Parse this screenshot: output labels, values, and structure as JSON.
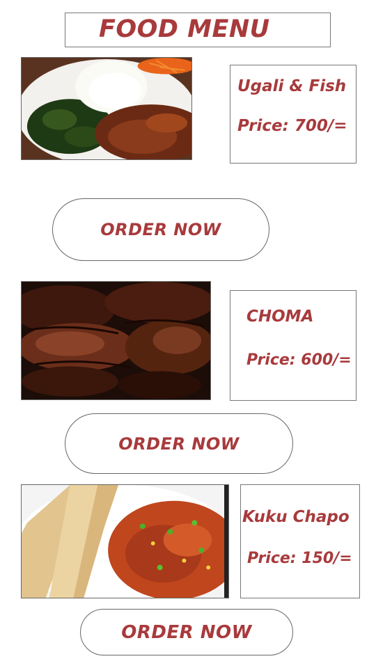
{
  "header": {
    "title": "FOOD MENU"
  },
  "menu": {
    "items": [
      {
        "name": "Ugali & Fish",
        "price": "Price: 700/=",
        "order_label": "ORDER NOW",
        "image": "ugali-fish-photo"
      },
      {
        "name": "CHOMA",
        "price": "Price: 600/=",
        "order_label": "ORDER NOW",
        "image": "nyama-choma-photo"
      },
      {
        "name": "Kuku Chapo",
        "price": "Price: 150/=",
        "order_label": "ORDER NOW",
        "image": "kuku-chapo-photo"
      }
    ]
  },
  "colors": {
    "accent": "#a83a3c",
    "border": "#777777",
    "background": "#ffffff"
  }
}
